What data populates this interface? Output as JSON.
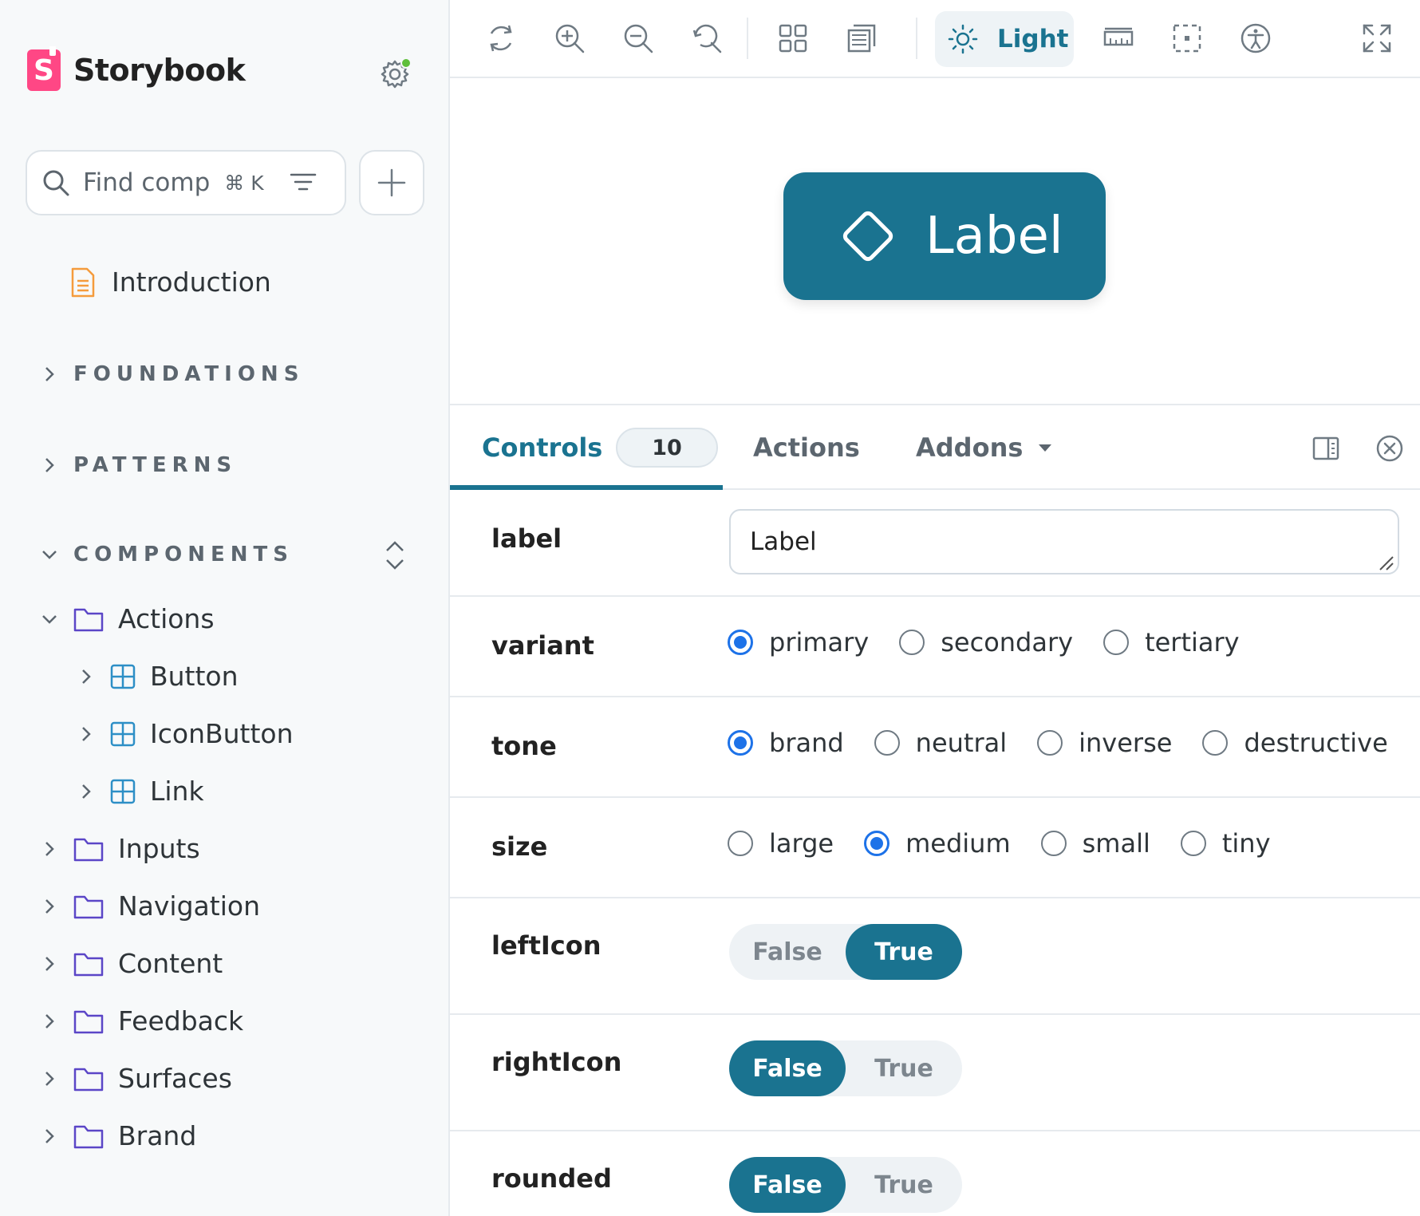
{
  "app": {
    "name": "Storybook"
  },
  "search": {
    "placeholder": "Find comp",
    "shortcut": "⌘ K"
  },
  "sidebar": {
    "intro": "Introduction",
    "sections": {
      "foundations": "FOUNDATIONS",
      "patterns": "PATTERNS",
      "components": "COMPONENTS"
    },
    "actions_folder": "Actions",
    "action_items": [
      "Button",
      "IconButton",
      "Link"
    ],
    "folders": [
      "Inputs",
      "Navigation",
      "Content",
      "Feedback",
      "Surfaces",
      "Brand"
    ]
  },
  "toolbar": {
    "theme_label": "Light"
  },
  "preview": {
    "button_label": "Label"
  },
  "panel": {
    "tabs": {
      "controls": "Controls",
      "controls_count": "10",
      "actions": "Actions",
      "addons": "Addons"
    },
    "controls": {
      "label": {
        "name": "label",
        "value": "Label"
      },
      "variant": {
        "name": "variant",
        "options": [
          "primary",
          "secondary",
          "tertiary"
        ],
        "selected": "primary"
      },
      "tone": {
        "name": "tone",
        "options": [
          "brand",
          "neutral",
          "inverse",
          "destructive"
        ],
        "selected": "brand"
      },
      "size": {
        "name": "size",
        "options": [
          "large",
          "medium",
          "small",
          "tiny"
        ],
        "selected": "medium"
      },
      "leftIcon": {
        "name": "leftIcon",
        "false_label": "False",
        "true_label": "True",
        "value": "True"
      },
      "rightIcon": {
        "name": "rightIcon",
        "false_label": "False",
        "true_label": "True",
        "value": "False"
      },
      "rounded": {
        "name": "rounded",
        "false_label": "False",
        "true_label": "True",
        "value": "False"
      }
    }
  },
  "colors": {
    "brand_pink": "#ff4785",
    "accent_teal": "#1a7390",
    "radio_blue": "#1d72e8",
    "status_green": "#5fbf3b"
  }
}
